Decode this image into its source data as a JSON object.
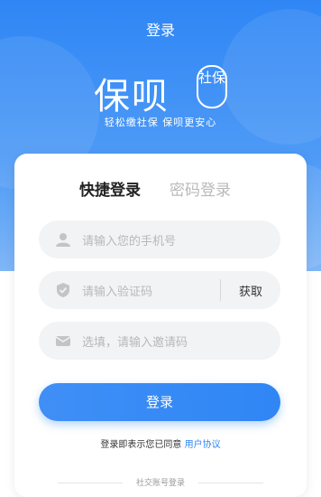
{
  "header": {
    "title": "登录"
  },
  "brand": {
    "name_main": "保呗",
    "name_badge": "社保",
    "slogan": "轻松缴社保 保呗更安心"
  },
  "tabs": [
    {
      "label": "快捷登录",
      "active": true
    },
    {
      "label": "密码登录",
      "active": false
    }
  ],
  "form": {
    "phone_placeholder": "请输入您的手机号",
    "code_placeholder": "请输入验证码",
    "get_code_label": "获取",
    "invite_placeholder": "选填，请输入邀请码"
  },
  "login_button": "登录",
  "agreement": {
    "prefix": "登录即表示您已同意 ",
    "link": "用户协议"
  },
  "social_login_label": "社交账号登录",
  "colors": {
    "primary": "#2f86f5",
    "field_bg": "#f2f3f5",
    "placeholder": "#b8b8b8"
  },
  "icons": {
    "phone": "user-icon",
    "code": "shield-icon",
    "invite": "mail-icon"
  }
}
